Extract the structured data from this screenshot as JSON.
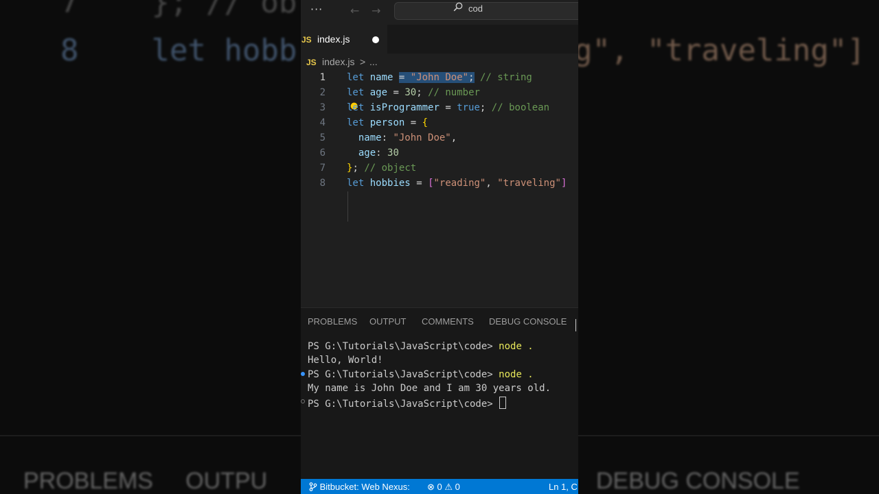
{
  "backdrop": {
    "left_line7": "7    }; // ob",
    "left_line8": "8    let hobb",
    "right_line8": "g\", \"traveling\"]",
    "left_panel": "PROBLEMS     OUTPU",
    "right_panel": "DEBUG CONSOLE"
  },
  "titlebar": {
    "more": "···",
    "back": "←",
    "forward": "→",
    "search_text": "cod"
  },
  "tab": {
    "badge": "JS",
    "label": "index.js"
  },
  "breadcrumb": {
    "badge": "JS",
    "file": "index.js",
    "separator": ">",
    "more": "..."
  },
  "editor": {
    "line_numbers": [
      "1",
      "2",
      "3",
      "4",
      "5",
      "6",
      "7",
      "8"
    ],
    "active_line": 1
  },
  "panel": {
    "tabs": [
      "PROBLEMS",
      "OUTPUT",
      "COMMENTS",
      "DEBUG CONSOLE"
    ],
    "terminal": [
      {
        "prompt": "PS G:\\Tutorials\\JavaScript\\code> ",
        "cmd": "node ."
      },
      {
        "text": "Hello, World!"
      },
      {
        "prompt": "PS G:\\Tutorials\\JavaScript\\code> ",
        "cmd": "node ."
      },
      {
        "text": "My name is John Doe and I am 30 years old."
      },
      {
        "prompt": "PS G:\\Tutorials\\JavaScript\\code> ",
        "cmd": ""
      }
    ]
  },
  "statusbar": {
    "branch": "Bitbucket: Web Nexus:",
    "errors": "0",
    "warnings": "0",
    "position": "Ln 1, C"
  },
  "colors": {
    "accent": "#0078d4",
    "editor_bg": "#1f1f1f",
    "selection": "#264f78"
  }
}
